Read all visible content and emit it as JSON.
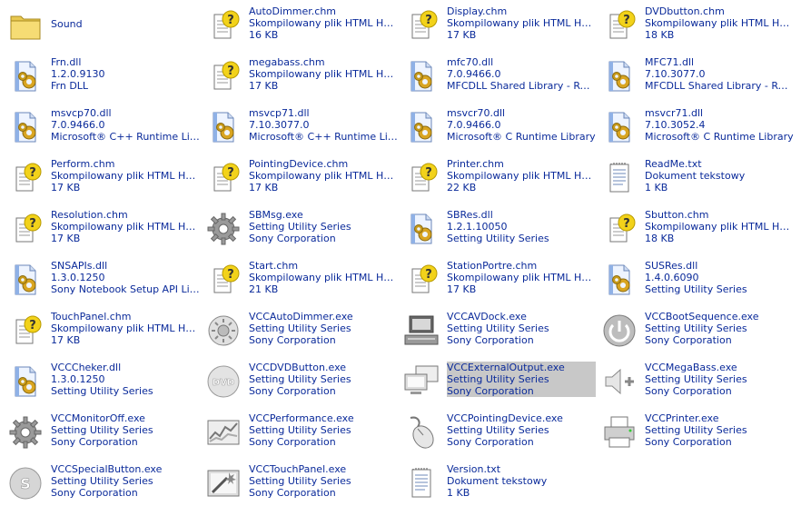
{
  "files": [
    {
      "name": "Sound",
      "line2": "",
      "line3": "",
      "icon": "folder-icon"
    },
    {
      "name": "AutoDimmer.chm",
      "line2": "Skompilowany plik HTML Help",
      "line3": "16 KB",
      "icon": "chm-help-icon"
    },
    {
      "name": "Display.chm",
      "line2": "Skompilowany plik HTML Help",
      "line3": "17 KB",
      "icon": "chm-help-icon"
    },
    {
      "name": "DVDbutton.chm",
      "line2": "Skompilowany plik HTML Help",
      "line3": "18 KB",
      "icon": "chm-help-icon"
    },
    {
      "name": "Frn.dll",
      "line2": "1.2.0.9130",
      "line3": "Frn DLL",
      "icon": "dll-icon"
    },
    {
      "name": "megabass.chm",
      "line2": "Skompilowany plik HTML Help",
      "line3": "17 KB",
      "icon": "chm-help-icon"
    },
    {
      "name": "mfc70.dll",
      "line2": "7.0.9466.0",
      "line3": "MFCDLL Shared Library - Retai...",
      "icon": "dll-icon"
    },
    {
      "name": "MFC71.dll",
      "line2": "7.10.3077.0",
      "line3": "MFCDLL Shared Library - Retai...",
      "icon": "dll-icon"
    },
    {
      "name": "msvcp70.dll",
      "line2": "7.0.9466.0",
      "line3": "Microsoft® C++ Runtime Library",
      "icon": "dll-icon"
    },
    {
      "name": "msvcp71.dll",
      "line2": "7.10.3077.0",
      "line3": "Microsoft® C++ Runtime Library",
      "icon": "dll-icon"
    },
    {
      "name": "msvcr70.dll",
      "line2": "7.0.9466.0",
      "line3": "Microsoft® C Runtime Library",
      "icon": "dll-icon"
    },
    {
      "name": "msvcr71.dll",
      "line2": "7.10.3052.4",
      "line3": "Microsoft® C Runtime Library",
      "icon": "dll-icon"
    },
    {
      "name": "Perform.chm",
      "line2": "Skompilowany plik HTML Help",
      "line3": "17 KB",
      "icon": "chm-help-icon"
    },
    {
      "name": "PointingDevice.chm",
      "line2": "Skompilowany plik HTML Help",
      "line3": "17 KB",
      "icon": "chm-help-icon"
    },
    {
      "name": "Printer.chm",
      "line2": "Skompilowany plik HTML Help",
      "line3": "22 KB",
      "icon": "chm-help-icon"
    },
    {
      "name": "ReadMe.txt",
      "line2": "Dokument tekstowy",
      "line3": "1 KB",
      "icon": "text-document-icon"
    },
    {
      "name": "Resolution.chm",
      "line2": "Skompilowany plik HTML Help",
      "line3": "17 KB",
      "icon": "chm-help-icon"
    },
    {
      "name": "SBMsg.exe",
      "line2": "Setting Utility Series",
      "line3": "Sony Corporation",
      "icon": "gear-icon"
    },
    {
      "name": "SBRes.dll",
      "line2": "1.2.1.10050",
      "line3": "Setting Utility Series",
      "icon": "dll-icon"
    },
    {
      "name": "Sbutton.chm",
      "line2": "Skompilowany plik HTML Help",
      "line3": "18 KB",
      "icon": "chm-help-icon"
    },
    {
      "name": "SNSAPIs.dll",
      "line2": "1.3.0.1250",
      "line3": "Sony Notebook Setup API Libr...",
      "icon": "dll-icon"
    },
    {
      "name": "Start.chm",
      "line2": "Skompilowany plik HTML Help",
      "line3": "21 KB",
      "icon": "chm-help-icon"
    },
    {
      "name": "StationPortre.chm",
      "line2": "Skompilowany plik HTML Help",
      "line3": "17 KB",
      "icon": "chm-help-icon"
    },
    {
      "name": "SUSRes.dll",
      "line2": "1.4.0.6090",
      "line3": "Setting Utility Series",
      "icon": "dll-icon"
    },
    {
      "name": "TouchPanel.chm",
      "line2": "Skompilowany plik HTML Help",
      "line3": "17 KB",
      "icon": "chm-help-icon"
    },
    {
      "name": "VCCAutoDimmer.exe",
      "line2": "Setting Utility Series",
      "line3": "Sony Corporation",
      "icon": "brightness-icon"
    },
    {
      "name": "VCCAVDock.exe",
      "line2": "Setting Utility Series",
      "line3": "Sony Corporation",
      "icon": "monitor-dock-icon"
    },
    {
      "name": "VCCBootSequence.exe",
      "line2": "Setting Utility Series",
      "line3": "Sony Corporation",
      "icon": "power-icon"
    },
    {
      "name": "VCCCheker.dll",
      "line2": "1.3.0.1250",
      "line3": "Setting Utility Series",
      "icon": "dll-icon"
    },
    {
      "name": "VCCDVDButton.exe",
      "line2": "Setting Utility Series",
      "line3": "Sony Corporation",
      "icon": "dvd-icon"
    },
    {
      "name": "VCCExternalOutput.exe",
      "line2": "Setting Utility Series",
      "line3": "Sony Corporation",
      "icon": "dual-monitor-icon",
      "selected": true
    },
    {
      "name": "VCCMegaBass.exe",
      "line2": "Setting Utility Series",
      "line3": "Sony Corporation",
      "icon": "speaker-icon"
    },
    {
      "name": "VCCMonitorOff.exe",
      "line2": "Setting Utility Series",
      "line3": "Sony Corporation",
      "icon": "gear-icon"
    },
    {
      "name": "VCCPerformance.exe",
      "line2": "Setting Utility Series",
      "line3": "Sony Corporation",
      "icon": "performance-icon"
    },
    {
      "name": "VCCPointingDevice.exe",
      "line2": "Setting Utility Series",
      "line3": "Sony Corporation",
      "icon": "mouse-icon"
    },
    {
      "name": "VCCPrinter.exe",
      "line2": "Setting Utility Series",
      "line3": "Sony Corporation",
      "icon": "printer-icon"
    },
    {
      "name": "VCCSpecialButton.exe",
      "line2": "Setting Utility Series",
      "line3": "Sony Corporation",
      "icon": "s-button-icon"
    },
    {
      "name": "VCCTouchPanel.exe",
      "line2": "Setting Utility Series",
      "line3": "Sony Corporation",
      "icon": "touch-panel-icon"
    },
    {
      "name": "Version.txt",
      "line2": "Dokument tekstowy",
      "line3": "1 KB",
      "icon": "text-document-icon"
    }
  ]
}
